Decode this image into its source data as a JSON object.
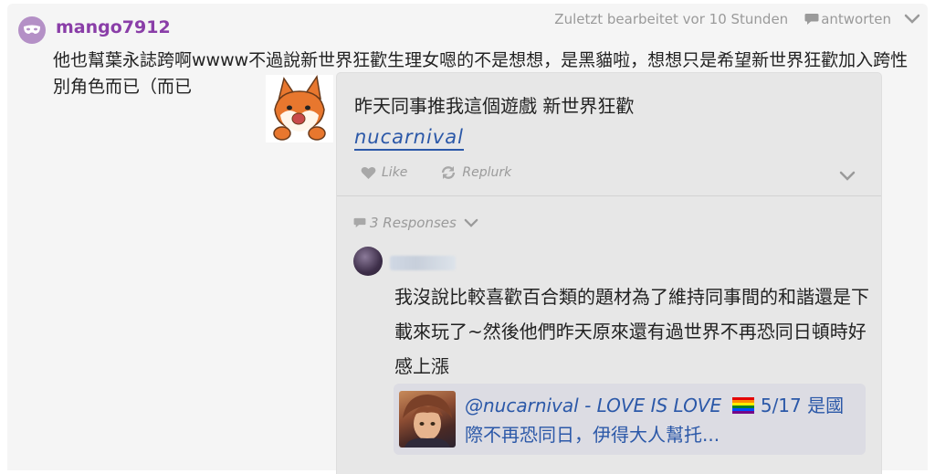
{
  "post": {
    "username": "mango7912",
    "edited": "Zuletzt bearbeitet vor 10 Stunden",
    "reply_label": "antworten",
    "text": "他也幫葉永誌跨啊wwww不過說新世界狂歡生理女嗯的不是想想，是黑貓啦，想想只是希望新世界狂歡加入跨性別角色而已（而已"
  },
  "embed": {
    "title": "昨天同事推我這個遊戲 新世界狂歡",
    "link": "nucarnival",
    "like_label": "Like",
    "replurk_label": "Replurk",
    "responses_label": "3 Responses"
  },
  "response": {
    "text": "我沒說比較喜歡百合類的題材為了維持同事間的和諧還是下載來玩了~然後他們昨天原來還有過世界不再恐同日頓時好感上漲",
    "card": {
      "handle": "@nucarnival - LOVE IS LOVE",
      "after_flag": " 5/17 是國際不再恐同日，伊得大人幫托..."
    }
  },
  "colors": {
    "username": "#8a3ea8",
    "link": "#2b58a8",
    "muted": "#9a9a9a"
  },
  "icons": {
    "avatar": "mask-icon",
    "reply": "speech-bubble-icon",
    "like": "heart-icon",
    "replurk": "replurk-icon",
    "responses": "speech-bubble-icon",
    "collapse": "chevron-down-icon",
    "flag": "rainbow-flag-icon"
  }
}
